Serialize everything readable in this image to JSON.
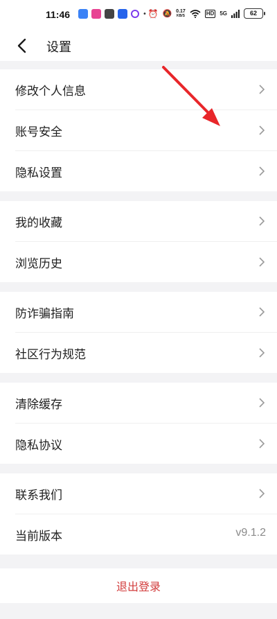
{
  "status_bar": {
    "time": "11:46",
    "net_speed_value": "0.17",
    "net_speed_unit": "KB/S",
    "hd_label": "HD",
    "signal_label": "5G",
    "battery": "62"
  },
  "header": {
    "back_icon": "chevron-left-icon",
    "title": "设置"
  },
  "groups": [
    {
      "items": [
        {
          "label": "修改个人信息"
        },
        {
          "label": "账号安全"
        },
        {
          "label": "隐私设置"
        }
      ]
    },
    {
      "items": [
        {
          "label": "我的收藏"
        },
        {
          "label": "浏览历史"
        }
      ]
    },
    {
      "items": [
        {
          "label": "防诈骗指南"
        },
        {
          "label": "社区行为规范"
        }
      ]
    },
    {
      "items": [
        {
          "label": "清除缓存"
        },
        {
          "label": "隐私协议"
        }
      ]
    },
    {
      "items": [
        {
          "label": "联系我们"
        },
        {
          "label": "当前版本",
          "value": "v9.1.2"
        }
      ]
    }
  ],
  "logout_label": "退出登录",
  "colors": {
    "background": "#f3f3f5",
    "logout_text": "#d23b3b",
    "annotation_arrow": "#e8262a"
  }
}
